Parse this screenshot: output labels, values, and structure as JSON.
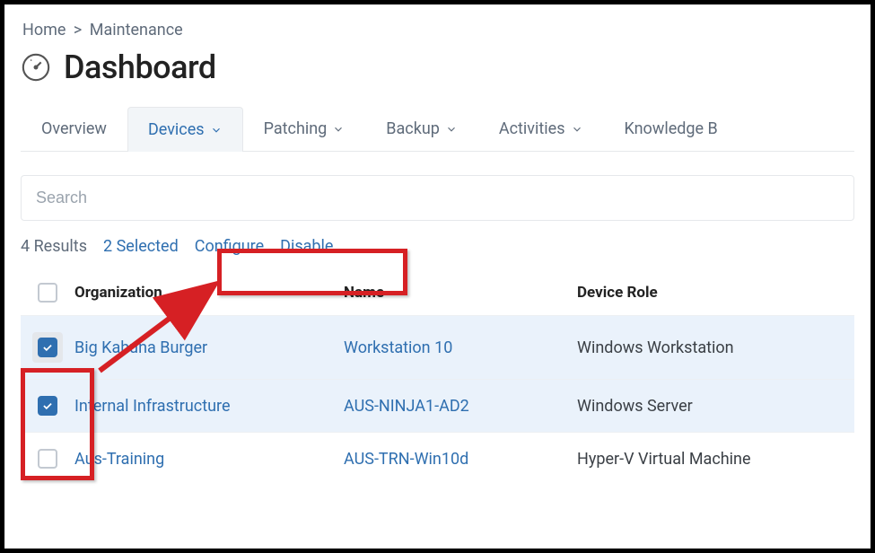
{
  "breadcrumb": {
    "home": "Home",
    "current": "Maintenance"
  },
  "page": {
    "title": "Dashboard"
  },
  "tabs": {
    "overview": "Overview",
    "devices": "Devices",
    "patching": "Patching",
    "backup": "Backup",
    "activities": "Activities",
    "knowledge": "Knowledge B"
  },
  "search": {
    "placeholder": "Search"
  },
  "results": {
    "count": "4 Results",
    "selected": "2 Selected"
  },
  "actions": {
    "configure": "Configure",
    "disable": "Disable"
  },
  "columns": {
    "organization": "Organization",
    "name": "Name",
    "device_role": "Device Role"
  },
  "rows": [
    {
      "organization": "Big Kahuna Burger",
      "name": "Workstation 10",
      "role": "Windows Workstation",
      "selected": true
    },
    {
      "organization": "Internal Infrastructure",
      "name": "AUS-NINJA1-AD2",
      "role": "Windows Server",
      "selected": true
    },
    {
      "organization": "Aus-Training",
      "name": "AUS-TRN-Win10d",
      "role": "Hyper-V Virtual Machine",
      "selected": false
    }
  ]
}
